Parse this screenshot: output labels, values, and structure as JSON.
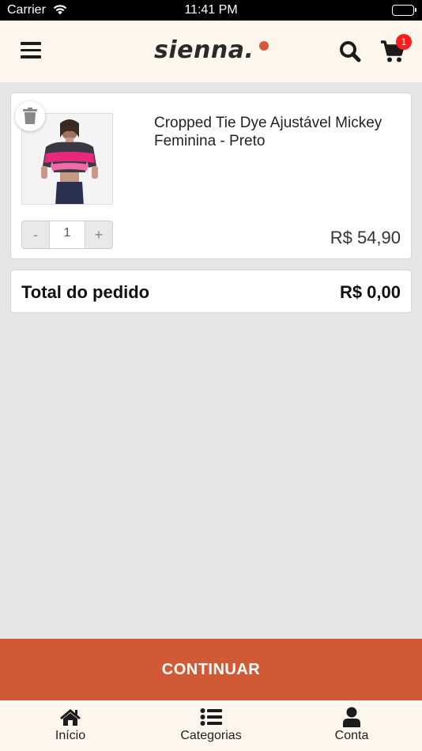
{
  "status_bar": {
    "carrier": "Carrier",
    "time": "11:41 PM"
  },
  "header": {
    "logo": "sienna.",
    "cart_badge": "1",
    "accent_color": "#d05a36"
  },
  "cart": {
    "items": [
      {
        "name": "Cropped Tie Dye Ajustável Mickey Feminina - Preto",
        "quantity": "1",
        "price": "R$ 54,90",
        "minus_label": "-",
        "plus_label": "+"
      }
    ],
    "total_label": "Total do pedido",
    "total_value": "R$ 0,00"
  },
  "actions": {
    "continue_label": "CONTINUAR"
  },
  "tab_bar": {
    "tabs": [
      {
        "label": "Início",
        "icon": "home-icon"
      },
      {
        "label": "Categorias",
        "icon": "list-icon"
      },
      {
        "label": "Conta",
        "icon": "user-icon"
      }
    ]
  }
}
